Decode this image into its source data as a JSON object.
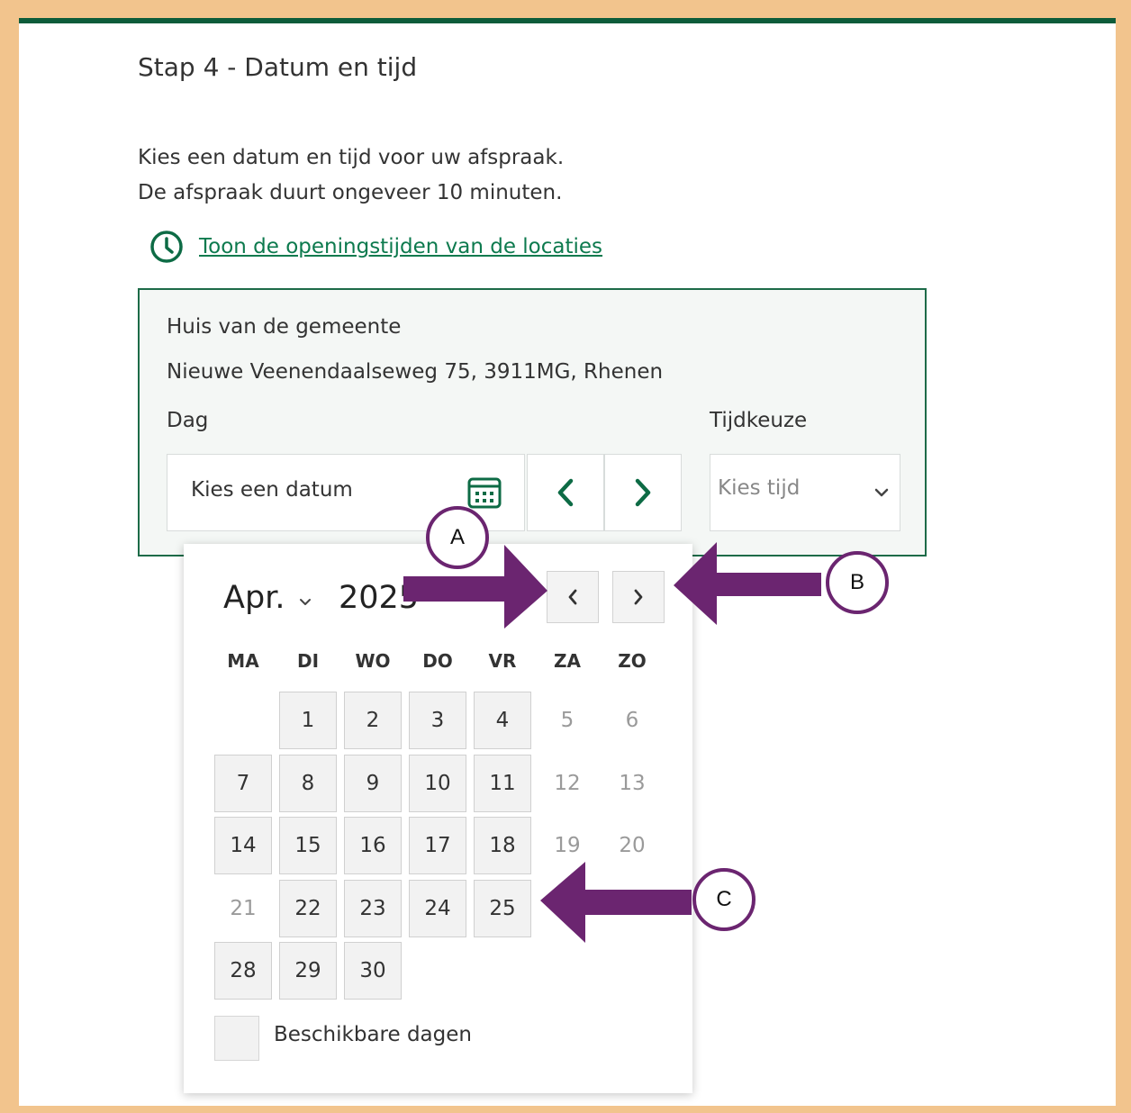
{
  "step_title": "Stap 4 - Datum en tijd",
  "intro": {
    "line1": "Kies een datum en tijd voor uw afspraak.",
    "line2": "De afspraak duurt ongeveer 10 minuten."
  },
  "hours_link": {
    "icon": "clock-icon",
    "label": "Toon de openingstijden van de locaties"
  },
  "location": {
    "name": "Huis van de gemeente",
    "address": "Nieuwe Veenendaalseweg 75, 3911MG, Rhenen",
    "day_label": "Dag",
    "date_placeholder": "Kies een datum",
    "time_label": "Tijdkeuze",
    "time_placeholder": "Kies tijd"
  },
  "calendar": {
    "month": "Apr.",
    "year": "2025",
    "weekdays": [
      "MA",
      "DI",
      "WO",
      "DO",
      "VR",
      "ZA",
      "ZO"
    ],
    "weeks": [
      [
        null,
        {
          "d": "1",
          "a": true
        },
        {
          "d": "2",
          "a": true
        },
        {
          "d": "3",
          "a": true
        },
        {
          "d": "4",
          "a": true
        },
        {
          "d": "5",
          "a": false
        },
        {
          "d": "6",
          "a": false
        }
      ],
      [
        {
          "d": "7",
          "a": true
        },
        {
          "d": "8",
          "a": true
        },
        {
          "d": "9",
          "a": true
        },
        {
          "d": "10",
          "a": true
        },
        {
          "d": "11",
          "a": true
        },
        {
          "d": "12",
          "a": false
        },
        {
          "d": "13",
          "a": false
        }
      ],
      [
        {
          "d": "14",
          "a": true
        },
        {
          "d": "15",
          "a": true
        },
        {
          "d": "16",
          "a": true
        },
        {
          "d": "17",
          "a": true
        },
        {
          "d": "18",
          "a": true
        },
        {
          "d": "19",
          "a": false
        },
        {
          "d": "20",
          "a": false
        }
      ],
      [
        {
          "d": "21",
          "a": false
        },
        {
          "d": "22",
          "a": true
        },
        {
          "d": "23",
          "a": true
        },
        {
          "d": "24",
          "a": true
        },
        {
          "d": "25",
          "a": true
        },
        null,
        null
      ],
      [
        {
          "d": "28",
          "a": true
        },
        {
          "d": "29",
          "a": true
        },
        {
          "d": "30",
          "a": true
        },
        null,
        null,
        null,
        null
      ]
    ],
    "legend": "Beschikbare dagen"
  },
  "annotations": {
    "a": "A",
    "b": "B",
    "c": "C"
  },
  "colors": {
    "brand_green": "#0d5c3a",
    "link_green": "#0d7a4e",
    "annotation_purple": "#6b2570",
    "frame": "#f2c48d"
  }
}
